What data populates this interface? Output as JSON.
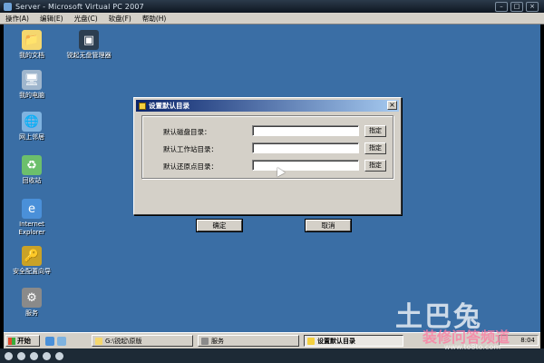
{
  "window": {
    "title": "Server - Microsoft Virtual PC 2007",
    "menu": [
      "操作(A)",
      "编辑(E)",
      "光盘(C)",
      "软盘(F)",
      "帮助(H)"
    ]
  },
  "desktop": {
    "icons": [
      {
        "label": "我的文档",
        "icon": "my-documents-icon"
      },
      {
        "label": "锐起无盘管理器",
        "icon": "diskless-manager-icon"
      },
      {
        "label": "我的电脑",
        "icon": "my-computer-icon"
      },
      {
        "label": "网上邻居",
        "icon": "network-icon"
      },
      {
        "label": "回收站",
        "icon": "recycle-bin-icon"
      },
      {
        "label": "Internet Explorer",
        "icon": "ie-icon"
      },
      {
        "label": "安全配置向导",
        "icon": "security-wizard-icon"
      },
      {
        "label": "服务",
        "icon": "services-icon"
      }
    ]
  },
  "dialog": {
    "title": "设置默认目录",
    "rows": [
      {
        "label": "默认磁盘目录：",
        "value": "",
        "button": "指定"
      },
      {
        "label": "默认工作站目录：",
        "value": "",
        "button": "指定"
      },
      {
        "label": "默认还原点目录：",
        "value": "",
        "button": "指定"
      }
    ],
    "ok": "确定",
    "cancel": "取消"
  },
  "taskbar": {
    "start": "开始",
    "tasks": [
      {
        "label": "G:\\锐起\\原版"
      },
      {
        "label": "服务"
      },
      {
        "label": "设置默认目录"
      }
    ],
    "clock": "8:04"
  },
  "watermark": {
    "title": "土巴兔",
    "subtitle": "装修问答频道",
    "url": "www.to8to.com"
  },
  "colors": {
    "desktop": "#3a6ea5",
    "dialog_title_start": "#0a246a",
    "dialog_title_end": "#a6caf0",
    "face": "#d4d0c8"
  }
}
